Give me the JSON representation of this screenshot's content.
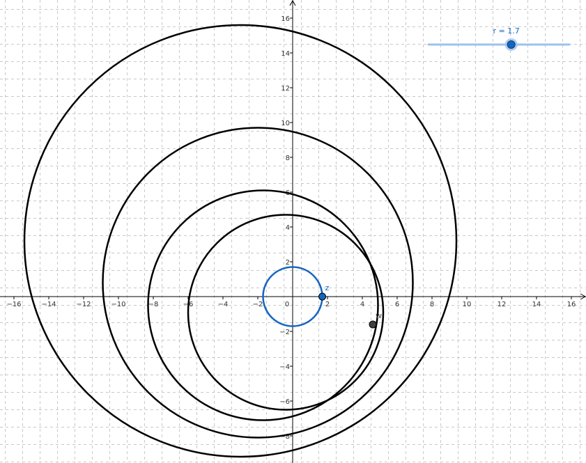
{
  "view": {
    "x_range": [
      -16.8,
      16.8
    ],
    "y_range": [
      -9.4,
      16.8
    ],
    "grid": true,
    "axis_ticks_x": [
      -16,
      -14,
      -12,
      -10,
      -8,
      -6,
      -4,
      -2,
      0,
      2,
      4,
      6,
      8,
      10,
      12,
      14,
      16
    ],
    "axis_ticks_y": [
      -8,
      -6,
      -4,
      -2,
      2,
      4,
      6,
      8,
      10,
      12,
      14,
      16
    ]
  },
  "colors": {
    "background": "#ffffff",
    "grid": "#c8c8c8",
    "axis": "#000000",
    "curve": "#000000",
    "accent": "#1565c0",
    "slider_track": "#9cc1ee",
    "point_dark": "#404040"
  },
  "slider": {
    "label": "r = 1.7",
    "value": 1.7,
    "min": -3,
    "max": 5
  },
  "curves": [
    {
      "name": "circle-1",
      "center": [
        -3.0,
        3.2
      ],
      "radius": 12.4
    },
    {
      "name": "circle-2",
      "center": [
        -2.0,
        0.8
      ],
      "radius": 8.9
    },
    {
      "name": "circle-3",
      "center": [
        -1.7,
        -0.5
      ],
      "radius": 6.6
    },
    {
      "name": "circle-4",
      "center": [
        -0.4,
        -0.9
      ],
      "radius": 5.6
    }
  ],
  "circle_z": {
    "center": [
      0,
      0
    ],
    "radius": 1.7
  },
  "points": [
    {
      "name": "point-z",
      "label": "z",
      "x": 1.7,
      "y": 0,
      "color": "#1565c0"
    },
    {
      "name": "point-w",
      "label": "w",
      "x": 4.6,
      "y": -1.6,
      "color": "#404040"
    }
  ]
}
